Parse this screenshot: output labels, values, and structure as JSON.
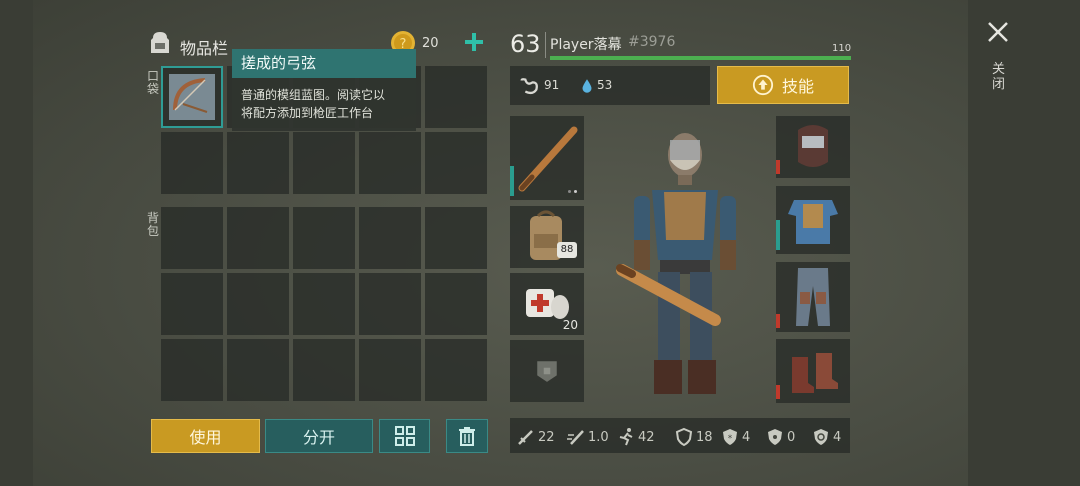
{
  "close": {
    "label": "关闭"
  },
  "inventory": {
    "title": "物品栏",
    "coin_value": "20",
    "pocket_label": "口袋",
    "backpack_label": "背包",
    "selected_item": {
      "name": "搓成的弓弦",
      "description_line1": "普通的模组蓝图。阅读它以",
      "description_line2": "将配方添加到枪匠工作台"
    },
    "buttons": {
      "use": "使用",
      "split": "分开"
    }
  },
  "player": {
    "level": "63",
    "name": "Player落幕",
    "tag": "#3976",
    "hp": "110",
    "hp_fraction": 1.0,
    "hunger": "91",
    "thirst": "53",
    "skills_label": "技能"
  },
  "equipment": {
    "medkit_count": "20",
    "backpack_badge": "88"
  },
  "stats": {
    "damage": "22",
    "attack_speed": "1.0",
    "move_speed": "42",
    "armor": "18",
    "res1": "4",
    "res2": "0",
    "res3": "4"
  },
  "colors": {
    "accent_yellow": "#c99a22",
    "accent_teal": "#275e5e",
    "hp_green": "#4caf50"
  }
}
